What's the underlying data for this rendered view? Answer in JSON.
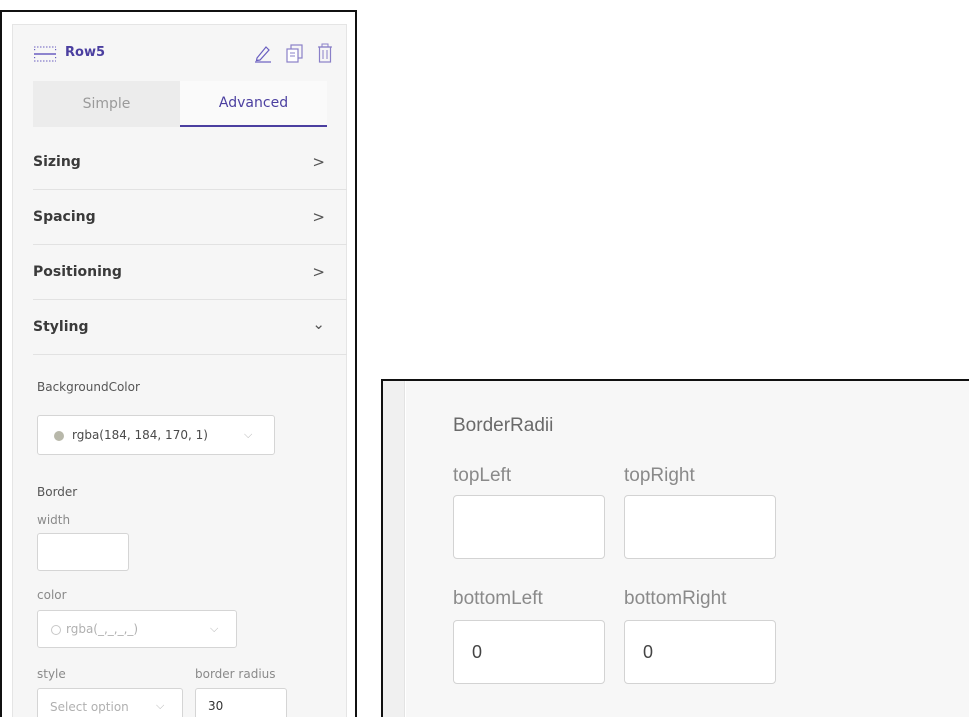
{
  "header": {
    "title": "Row5",
    "icons": [
      "row-layout-icon",
      "pencil-icon",
      "copy-icon",
      "trash-icon"
    ]
  },
  "tabs": [
    {
      "label": "Simple"
    },
    {
      "label": "Advanced"
    }
  ],
  "sections": [
    {
      "label": "Sizing",
      "chevron": ">"
    },
    {
      "label": "Spacing",
      "chevron": ">"
    },
    {
      "label": "Positioning",
      "chevron": ">"
    },
    {
      "label": "Styling",
      "chevron": "⌄"
    }
  ],
  "styling": {
    "background_label": "BackgroundColor",
    "background_value": "rgba(184, 184, 170, 1)",
    "border_label": "Border",
    "width_label": "width",
    "width_value": "",
    "color_label": "color",
    "color_value": "rgba(_,_,_,_)",
    "style_label": "style",
    "style_placeholder": "Select option",
    "radius_label": "border radius",
    "radius_value": "30"
  },
  "zoom": {
    "title": "BorderRadii",
    "top_left_label": "topLeft",
    "top_left_value": "",
    "top_right_label": "topRight",
    "top_right_value": "",
    "bottom_left_label": "bottomLeft",
    "bottom_left_value": "0",
    "bottom_right_label": "bottomRight",
    "bottom_right_value": "0"
  },
  "colors": {
    "accent": "#4b3fa0",
    "swatch": "#b8b8aa"
  }
}
